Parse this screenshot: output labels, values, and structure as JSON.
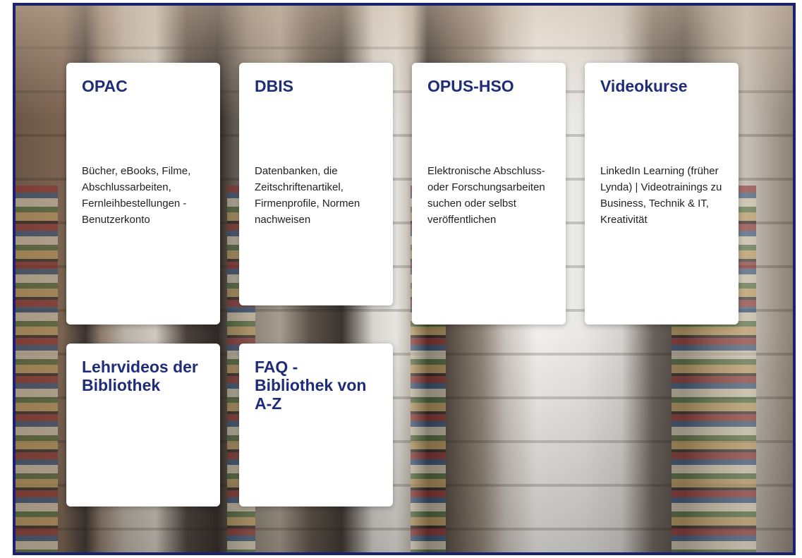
{
  "cards": [
    {
      "title": "OPAC",
      "description": "Bücher, eBooks, Filme, Abschlussarbeiten, Fernleihbestellungen - Benutzerkonto"
    },
    {
      "title": "DBIS",
      "description": "Datenbanken, die Zeitschriftenartikel, Firmenprofile, Normen nachweisen"
    },
    {
      "title": "OPUS-HSO",
      "description": "Elektronische Abschluss- oder Forschungsarbeiten suchen oder selbst veröffentlichen"
    },
    {
      "title": "Videokurse",
      "description": "LinkedIn Learning (früher Lynda) | Videotrainings zu Business, Technik & IT, Kreativität"
    },
    {
      "title": "Lehrvideos der Bibliothek",
      "description": ""
    },
    {
      "title": "FAQ - Bibliothek von A-Z",
      "description": ""
    }
  ],
  "colors": {
    "frame_border": "#1a2270",
    "title": "#1f2d78",
    "card_bg": "#ffffff"
  }
}
